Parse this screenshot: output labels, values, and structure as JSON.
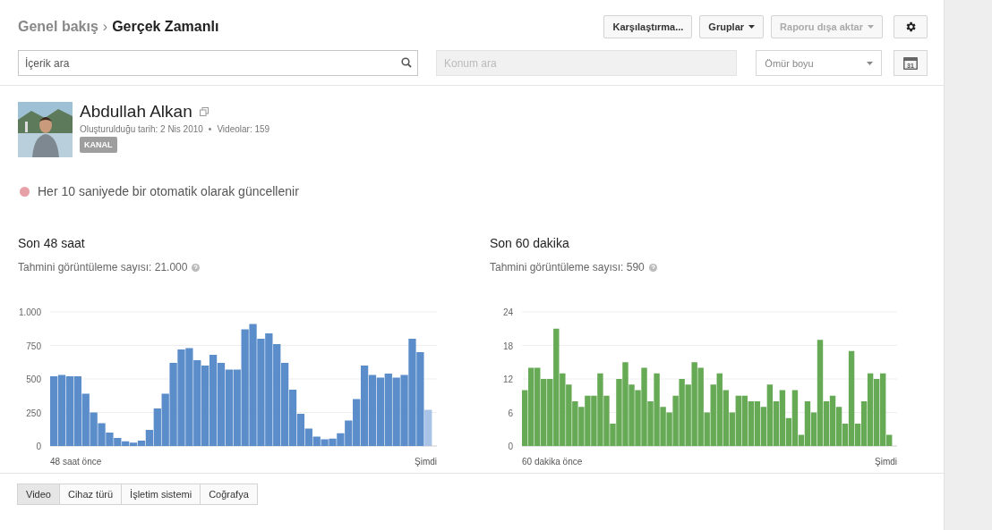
{
  "breadcrumb": {
    "parent": "Genel bakış",
    "separator": "›",
    "current": "Gerçek Zamanlı"
  },
  "toolbar": {
    "buttons": [
      {
        "label": "Karşılaştırma...",
        "dropdown": false,
        "disabled": false
      },
      {
        "label": "Gruplar",
        "dropdown": true,
        "disabled": false
      },
      {
        "label": "Raporu dışa aktar",
        "dropdown": true,
        "disabled": true
      }
    ]
  },
  "filters": {
    "content_search": {
      "placeholder": "İçerik ara"
    },
    "location_search": {
      "placeholder": "Konum ara",
      "disabled": true
    },
    "period": {
      "value": "Ömür boyu"
    },
    "calendar_day": "31"
  },
  "channel": {
    "name": "Abdullah Alkan",
    "created": "Oluşturulduğu tarih: 2 Nis 2010",
    "separator": "•",
    "videos": "Videolar: 159",
    "badge": "KANAL"
  },
  "live_status": {
    "text": "Her 10 saniyede bir otomatik olarak güncellenir",
    "color": "#e8a0a8"
  },
  "charts": [
    {
      "title": "Son 48 saat",
      "subtitle": "Tahmini görüntüleme sayısı: 21.000",
      "start_label": "48 saat önce",
      "end_label": "Şimdi",
      "chart_data": {
        "type": "bar",
        "grid": true,
        "ylim": [
          0,
          1000
        ],
        "yticks": [
          0,
          {
            "value": 250,
            "label": "250"
          },
          {
            "value": 500,
            "label": "500"
          },
          {
            "value": 750,
            "label": "750"
          },
          {
            "value": 1000,
            "label": "1.000"
          }
        ],
        "series": [
          {
            "color": "#5b8dcb",
            "values": [
              520,
              530,
              520,
              520,
              390,
              250,
              170,
              100,
              60,
              35,
              25,
              40,
              120,
              280,
              390,
              620,
              720,
              730,
              640,
              600,
              680,
              620,
              570,
              570,
              870,
              910,
              800,
              840,
              760,
              620,
              420,
              240,
              130,
              70,
              50,
              55,
              95,
              190,
              350,
              600,
              530,
              510,
              540,
              510,
              530,
              800,
              700,
              null
            ]
          },
          {
            "color": "#a9c3e6",
            "values": [
              null,
              null,
              null,
              null,
              null,
              null,
              null,
              null,
              null,
              null,
              null,
              null,
              null,
              null,
              null,
              null,
              null,
              null,
              null,
              null,
              null,
              null,
              null,
              null,
              null,
              null,
              null,
              null,
              null,
              null,
              null,
              null,
              null,
              null,
              null,
              null,
              null,
              null,
              null,
              null,
              null,
              null,
              null,
              null,
              null,
              null,
              null,
              270
            ]
          }
        ]
      }
    },
    {
      "title": "Son 60 dakika",
      "subtitle": "Tahmini görüntüleme sayısı: 590",
      "start_label": "60 dakika önce",
      "end_label": "Şimdi",
      "chart_data": {
        "type": "bar",
        "grid": true,
        "ylim": [
          0,
          24
        ],
        "yticks": [
          0,
          6,
          12,
          18,
          24
        ],
        "series": [
          {
            "color": "#66aa55",
            "values": [
              10,
              14,
              14,
              12,
              12,
              21,
              13,
              11,
              8,
              7,
              9,
              9,
              13,
              9,
              4,
              12,
              15,
              11,
              10,
              14,
              8,
              13,
              7,
              6,
              9,
              12,
              11,
              15,
              14,
              6,
              11,
              13,
              10,
              6,
              9,
              9,
              8,
              8,
              7,
              11,
              8,
              10,
              5,
              10,
              2,
              8,
              6,
              19,
              8,
              9,
              7,
              4,
              17,
              4,
              8,
              13,
              12,
              13,
              2
            ]
          }
        ]
      }
    }
  ],
  "tabs": [
    {
      "label": "Video",
      "selected": true
    },
    {
      "label": "Cihaz türü",
      "selected": false
    },
    {
      "label": "İşletim sistemi",
      "selected": false
    },
    {
      "label": "Coğrafya",
      "selected": false
    }
  ]
}
